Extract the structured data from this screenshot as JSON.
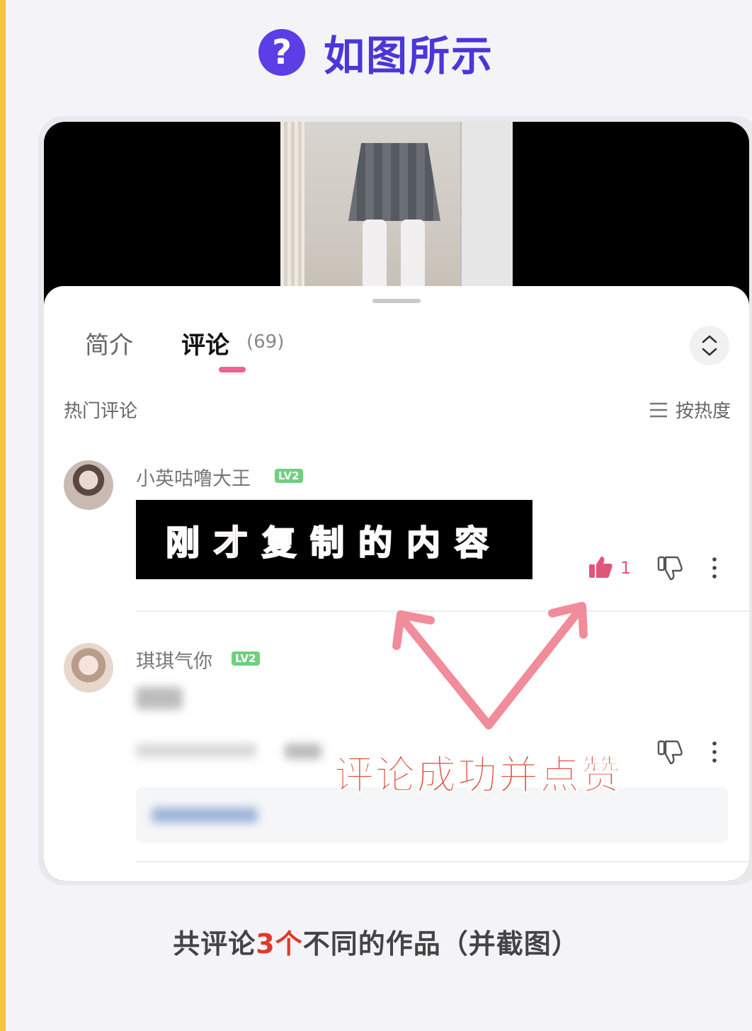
{
  "header": {
    "icon": "question-circle-icon",
    "icon_glyph": "?",
    "title": "如图所示"
  },
  "panel": {
    "tabs": [
      {
        "label": "简介",
        "active": false
      },
      {
        "label": "评论",
        "active": true,
        "count": "(69)"
      }
    ],
    "section_label": "热门评论",
    "sort_label": "按热度",
    "comments": [
      {
        "username": "小英咕噜大王",
        "level": "LV2",
        "content": "刚才复制的内容",
        "likes": "1",
        "liked": true
      },
      {
        "username": "琪琪气你",
        "level": "LV2"
      }
    ]
  },
  "annotation": {
    "text": "评论成功并点赞",
    "color": "#e0503c"
  },
  "footer": {
    "prefix": "共评论",
    "highlight": "3个",
    "suffix": "不同的作品（并截图）",
    "highlight_color": "#e0382c"
  },
  "colors": {
    "accent_purple": "#5b3ee6",
    "tab_underline": "#f06292",
    "like_pink": "#e0557a",
    "level_badge": "#6fcf7f",
    "left_stripe": "#f6c342"
  }
}
